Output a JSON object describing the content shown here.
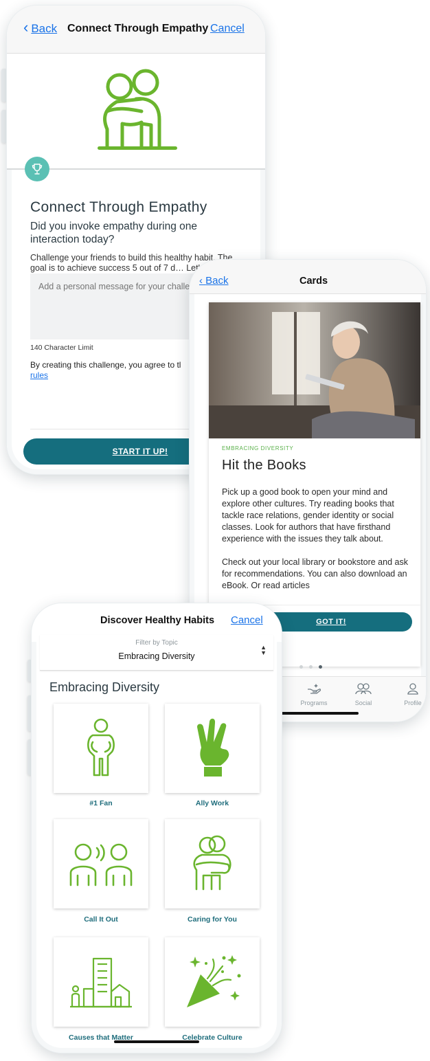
{
  "colors": {
    "primary_button": "#156e7e",
    "link": "#1a73e8",
    "icon_green": "#6ab52e",
    "badge_teal": "#5bc0b4",
    "tile_label": "#1f6d7c"
  },
  "challenge_screen": {
    "nav": {
      "back_label": "Back",
      "title": "Connect Through Empathy",
      "cancel_label": "Cancel"
    },
    "hero_icon": "hugging-people-icon",
    "badge_icon": "trophy-icon",
    "heading": "Connect Through Empathy",
    "question": "Did you invoke empathy during one interaction today?",
    "description": "Challenge your friends to build this healthy habit. The goal is to achieve success 5 out of 7 d… Let's do this!",
    "message_placeholder": "Add a personal message for your challer",
    "character_limit": "140 Character Limit",
    "terms_text": "By creating this challenge, you agree to tl",
    "terms_link": "rules",
    "start_button": "START IT UP!"
  },
  "cards_screen": {
    "nav": {
      "back_label": "Back",
      "title": "Cards"
    },
    "card": {
      "category": "EMBRACING DIVERSITY",
      "title": "Hit the Books",
      "paragraphs": [
        "Pick up a good book to open your mind and explore other cultures. Try reading books that tackle race relations, gender identity or social classes. Look for authors that have firsthand experience with the issues they talk about.",
        "Check out your local library or bookstore and ask for recommendations. You can also download an eBook. Or read articles"
      ],
      "button": "GOT IT!"
    },
    "pager": {
      "total": 3,
      "active_index": 2
    },
    "tabs": [
      {
        "label": "Programs",
        "icon": "hand-sparkle-icon"
      },
      {
        "label": "Social",
        "icon": "people-icon"
      },
      {
        "label": "Profile",
        "icon": "person-icon"
      }
    ]
  },
  "discover_screen": {
    "nav": {
      "title": "Discover Healthy Habits",
      "cancel_label": "Cancel"
    },
    "filter": {
      "label": "Filter by Topic",
      "value": "Embracing Diversity"
    },
    "section_title": "Embracing Diversity",
    "tiles": [
      {
        "label": "#1 Fan",
        "icon": "foam-finger-person-icon"
      },
      {
        "label": "Ally Work",
        "icon": "three-finger-hand-icon"
      },
      {
        "label": "Call It Out",
        "icon": "speaking-people-icon"
      },
      {
        "label": "Caring for You",
        "icon": "hug-icon"
      },
      {
        "label": "Causes that Matter",
        "icon": "city-building-icon"
      },
      {
        "label": "Celebrate Culture",
        "icon": "party-popper-icon"
      }
    ]
  }
}
